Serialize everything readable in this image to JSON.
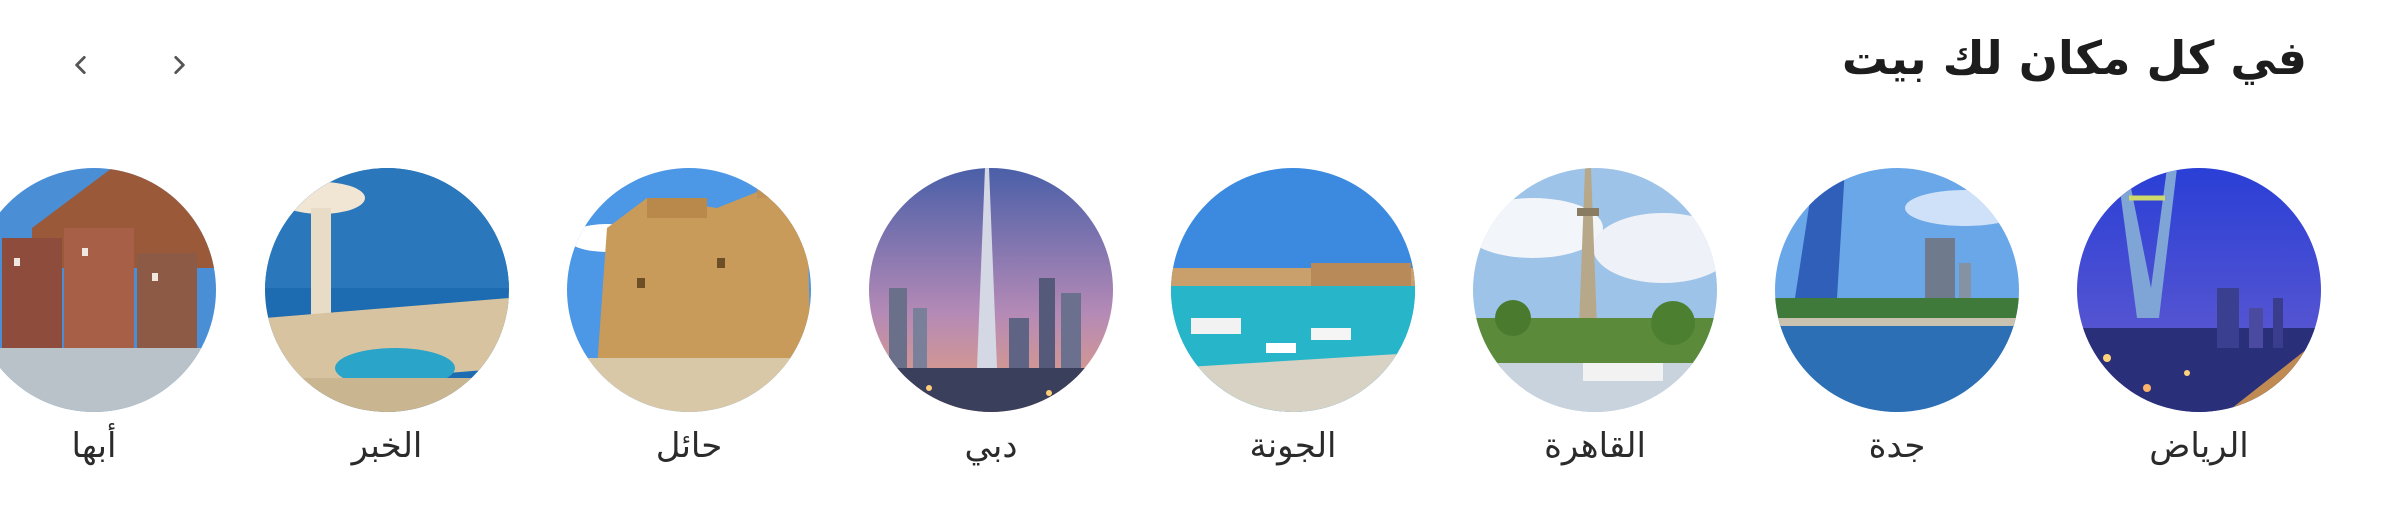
{
  "section": {
    "title": "في كل مكان لك بيت"
  },
  "nav": {
    "prev_icon": "chevron-left-icon",
    "next_icon": "chevron-right-icon"
  },
  "cities": [
    {
      "name": "الرياض"
    },
    {
      "name": "جدة"
    },
    {
      "name": "القاهرة"
    },
    {
      "name": "الجونة"
    },
    {
      "name": "دبي"
    },
    {
      "name": "حائل"
    },
    {
      "name": "الخبر"
    },
    {
      "name": "أبها"
    }
  ]
}
